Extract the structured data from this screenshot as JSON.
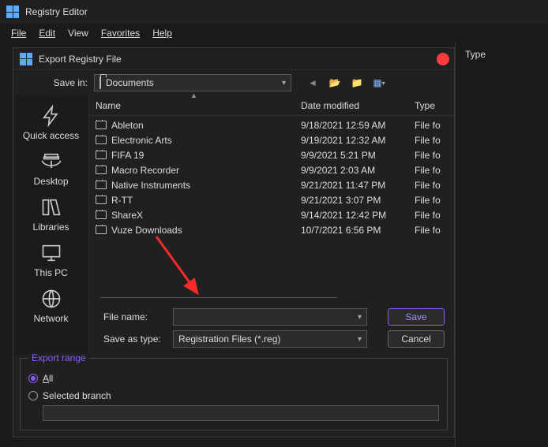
{
  "app": {
    "title": "Registry Editor"
  },
  "menu": {
    "file": "File",
    "edit": "Edit",
    "view": "View",
    "favorites": "Favorites",
    "help": "Help"
  },
  "right_panel": {
    "col_type": "Type"
  },
  "dialog": {
    "title": "Export Registry File",
    "save_in_label": "Save in:",
    "save_in_value": "Documents",
    "places": {
      "quick_access": "Quick access",
      "desktop": "Desktop",
      "libraries": "Libraries",
      "this_pc": "This PC",
      "network": "Network"
    },
    "columns": {
      "name": "Name",
      "date": "Date modified",
      "type": "Type"
    },
    "rows": [
      {
        "name": "Ableton",
        "date": "9/18/2021 12:59 AM",
        "type": "File fo"
      },
      {
        "name": "Electronic Arts",
        "date": "9/19/2021 12:32 AM",
        "type": "File fo"
      },
      {
        "name": "FIFA 19",
        "date": "9/9/2021 5:21 PM",
        "type": "File fo"
      },
      {
        "name": "Macro Recorder",
        "date": "9/9/2021 2:03 AM",
        "type": "File fo"
      },
      {
        "name": "Native Instruments",
        "date": "9/21/2021 11:47 PM",
        "type": "File fo"
      },
      {
        "name": "R-TT",
        "date": "9/21/2021 3:07 PM",
        "type": "File fo"
      },
      {
        "name": "ShareX",
        "date": "9/14/2021 12:42 PM",
        "type": "File fo"
      },
      {
        "name": "Vuze Downloads",
        "date": "10/7/2021 6:56 PM",
        "type": "File fo"
      }
    ],
    "file_name_label": "File name:",
    "file_name_value": "",
    "save_as_type_label": "Save as type:",
    "save_as_type_value": "Registration Files (*.reg)",
    "save_btn": "Save",
    "cancel_btn": "Cancel",
    "export_range": {
      "legend": "Export range",
      "all": "All",
      "selected": "Selected branch",
      "branch_value": ""
    }
  }
}
